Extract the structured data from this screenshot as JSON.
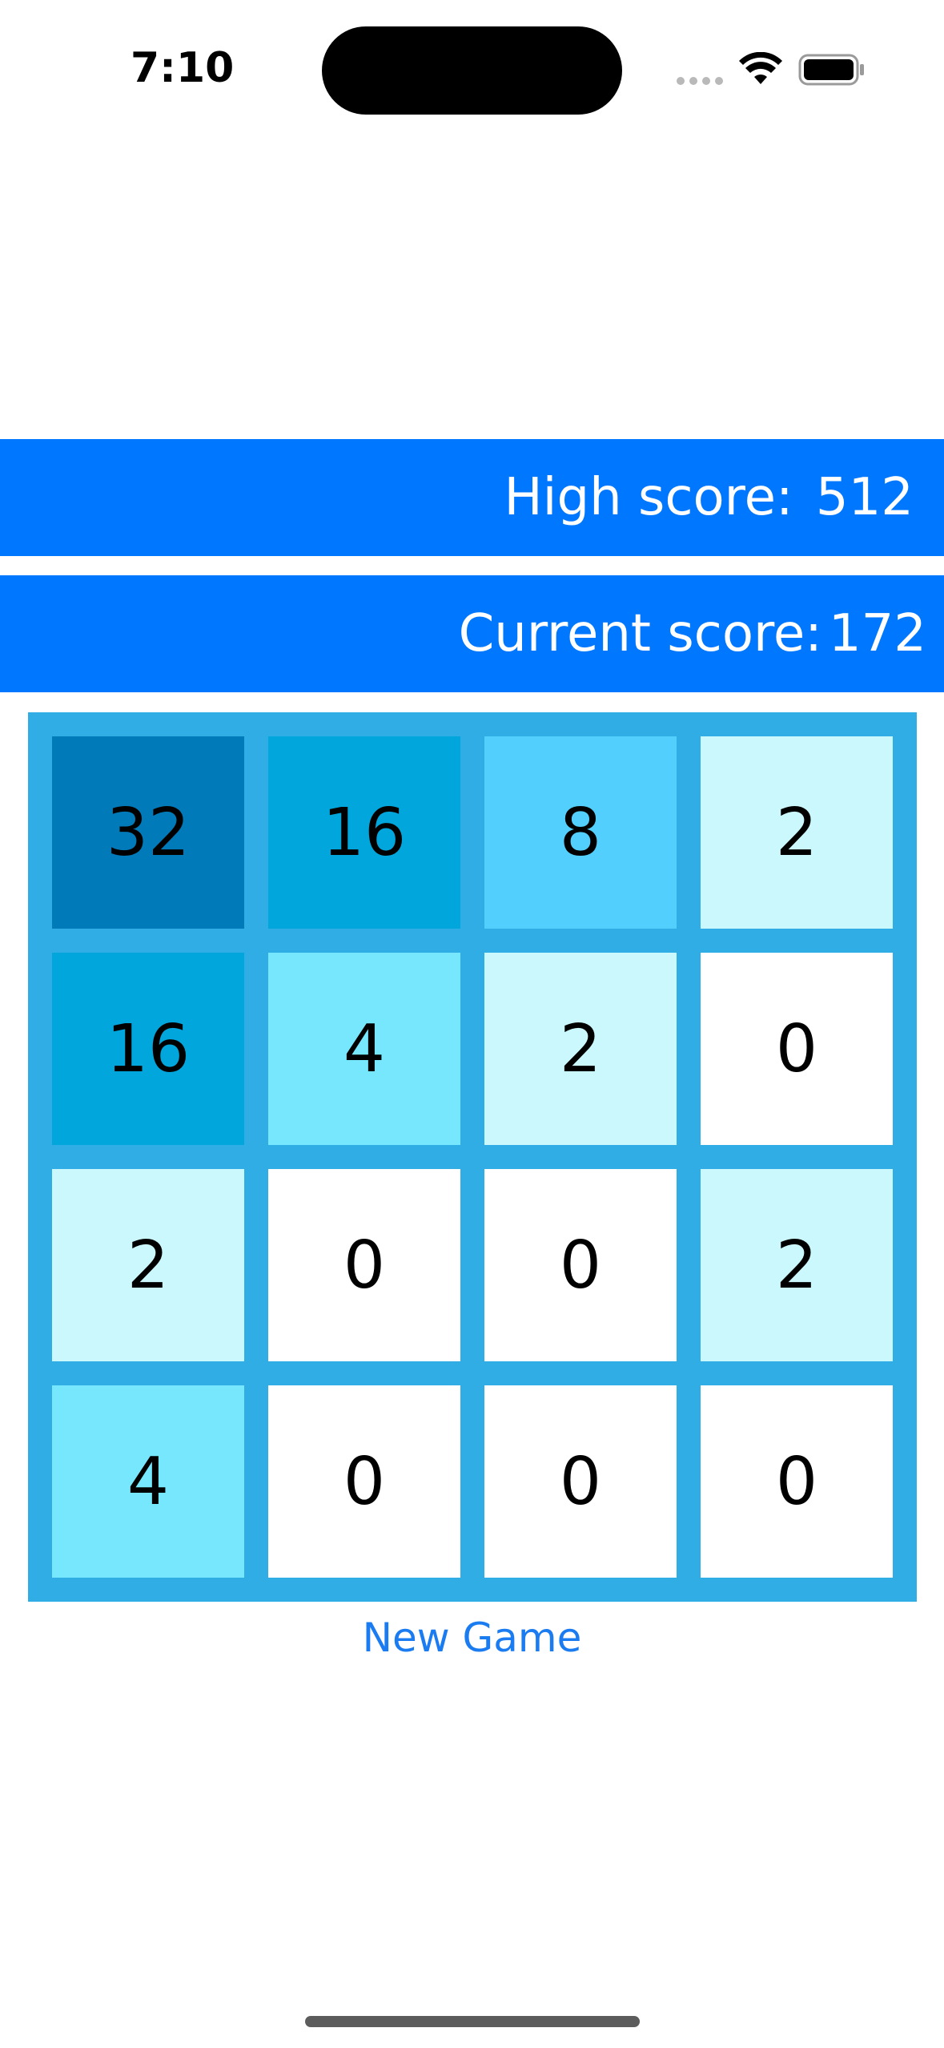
{
  "status_bar": {
    "time": "7:10"
  },
  "high_score": {
    "label": "High score: ",
    "value": "512"
  },
  "current_score": {
    "label": "Current score:",
    "value": "172"
  },
  "board": {
    "rows": [
      [
        "32",
        "16",
        "8",
        "2"
      ],
      [
        "16",
        "4",
        "2",
        "0"
      ],
      [
        "2",
        "0",
        "0",
        "2"
      ],
      [
        "4",
        "0",
        "0",
        "0"
      ]
    ],
    "tile_colors": {
      "0": "#ffffff",
      "2": "#cbf8fd",
      "4": "#76e7fd",
      "8": "#52cffd",
      "16": "#00a6dc",
      "32": "#007ab8"
    },
    "board_color": "#31ade6"
  },
  "actions": {
    "new_game_label": "New Game"
  },
  "colors": {
    "score_bar": "#0077ff",
    "accent": "#1a7cf0"
  }
}
